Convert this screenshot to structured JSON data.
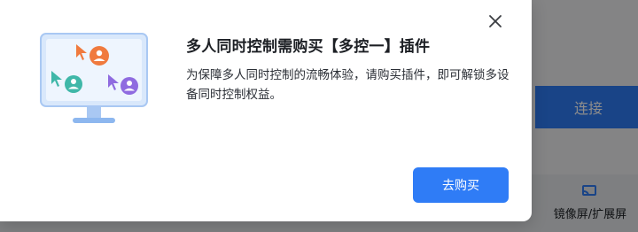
{
  "dialog": {
    "title": "多人同时控制需购买【多控一】插件",
    "description": "为保障多人同时控制的流畅体验，请购买插件，即可解锁多设备同时控制权益。",
    "buy_label": "去购买",
    "close_icon": "close-icon"
  },
  "background": {
    "connect_label": "连接",
    "tool_label": "镜像屏/扩展屏",
    "tool_icon": "screen-cast-icon"
  },
  "colors": {
    "accent": "#2f7cf6",
    "title_text": "#1c1f24",
    "body_text": "#2b2f36",
    "avatar_orange": "#f07a3e",
    "avatar_teal": "#3fb7a8",
    "avatar_purple": "#8f6be0"
  }
}
